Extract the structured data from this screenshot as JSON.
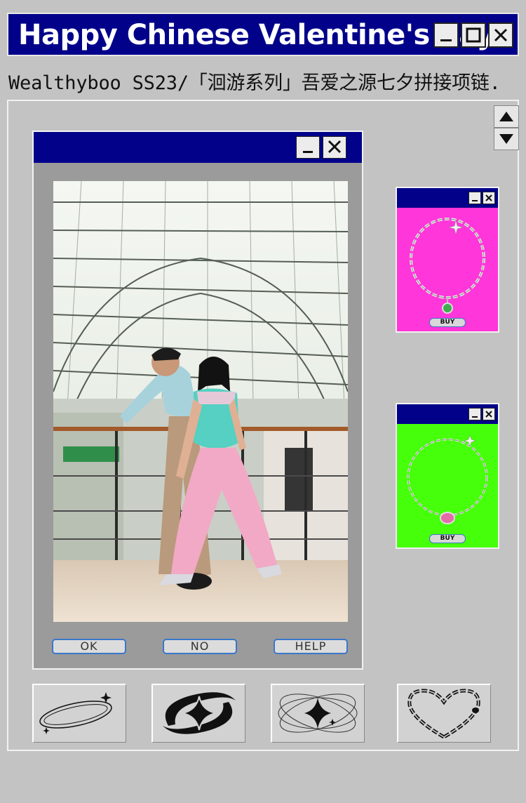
{
  "window": {
    "title": "Happy Chinese Valentine's day.",
    "colors": {
      "titlebar": "#01018a",
      "frame": "#c3c3c3"
    }
  },
  "subtitle": "Wealthyboo SS23/「洄游系列」吾爱之源七夕拼接项链.",
  "photo_window": {
    "buttons": {
      "ok": "OK",
      "no": "NO",
      "help": "HELP"
    },
    "photo_icon": "couple-photo"
  },
  "products": [
    {
      "buy_label": "BUY",
      "bg_color": "#ff36d9",
      "icon": "silver-chain-necklace-green-pendant"
    },
    {
      "buy_label": "BUY",
      "bg_color": "#46ff0a",
      "icon": "silver-chain-necklace-pink-pendant"
    }
  ],
  "icons": [
    "orbit-sparkle-icon",
    "star-swoosh-icon",
    "atom-sparkle-icon",
    "chain-heart-icon"
  ]
}
